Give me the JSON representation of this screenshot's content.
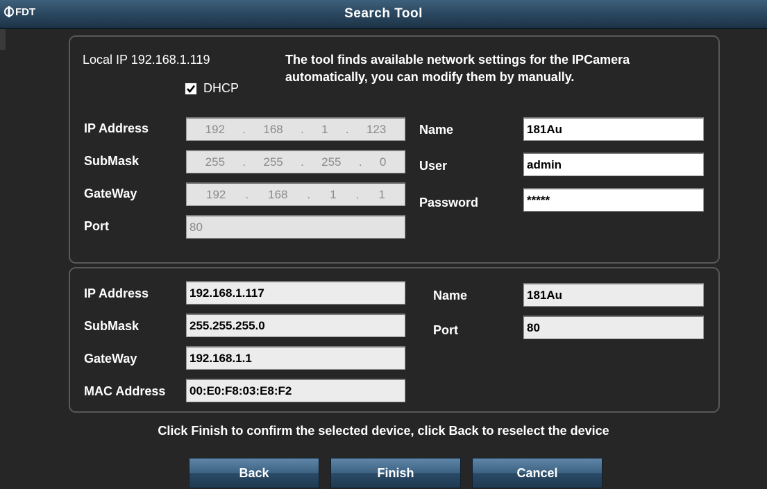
{
  "window": {
    "app_logo": "FDT",
    "title": "Search Tool"
  },
  "local": {
    "local_ip_label": "Local IP 192.168.1.119",
    "dhcp_label": "DHCP",
    "dhcp_checked": true,
    "info_line1": "The tool finds available network settings for the IPCamera",
    "info_line2": "automatically, you can modify them by manually."
  },
  "config": {
    "ip_label": "IP Address",
    "ip_octets": [
      "192",
      "168",
      "1",
      "123"
    ],
    "submask_label": "SubMask",
    "submask_octets": [
      "255",
      "255",
      "255",
      "0"
    ],
    "gateway_label": "GateWay",
    "gateway_octets": [
      "192",
      "168",
      "1",
      "1"
    ],
    "port_label": "Port",
    "port_value": "80",
    "name_label": "Name",
    "name_value": "181Au",
    "user_label": "User",
    "user_value": "admin",
    "password_label": "Password",
    "password_value": "*****"
  },
  "device": {
    "ip_label": "IP Address",
    "ip_value": "192.168.1.117",
    "submask_label": "SubMask",
    "submask_value": "255.255.255.0",
    "gateway_label": "GateWay",
    "gateway_value": "192.168.1.1",
    "mac_label": "MAC Address",
    "mac_value": "00:E0:F8:03:E8:F2",
    "name_label": "Name",
    "name_value": "181Au",
    "port_label": "Port",
    "port_value": "80"
  },
  "footer": {
    "instruction": "Click Finish to confirm the selected device, click Back to reselect the device",
    "back_label": "Back",
    "finish_label": "Finish",
    "cancel_label": "Cancel"
  }
}
